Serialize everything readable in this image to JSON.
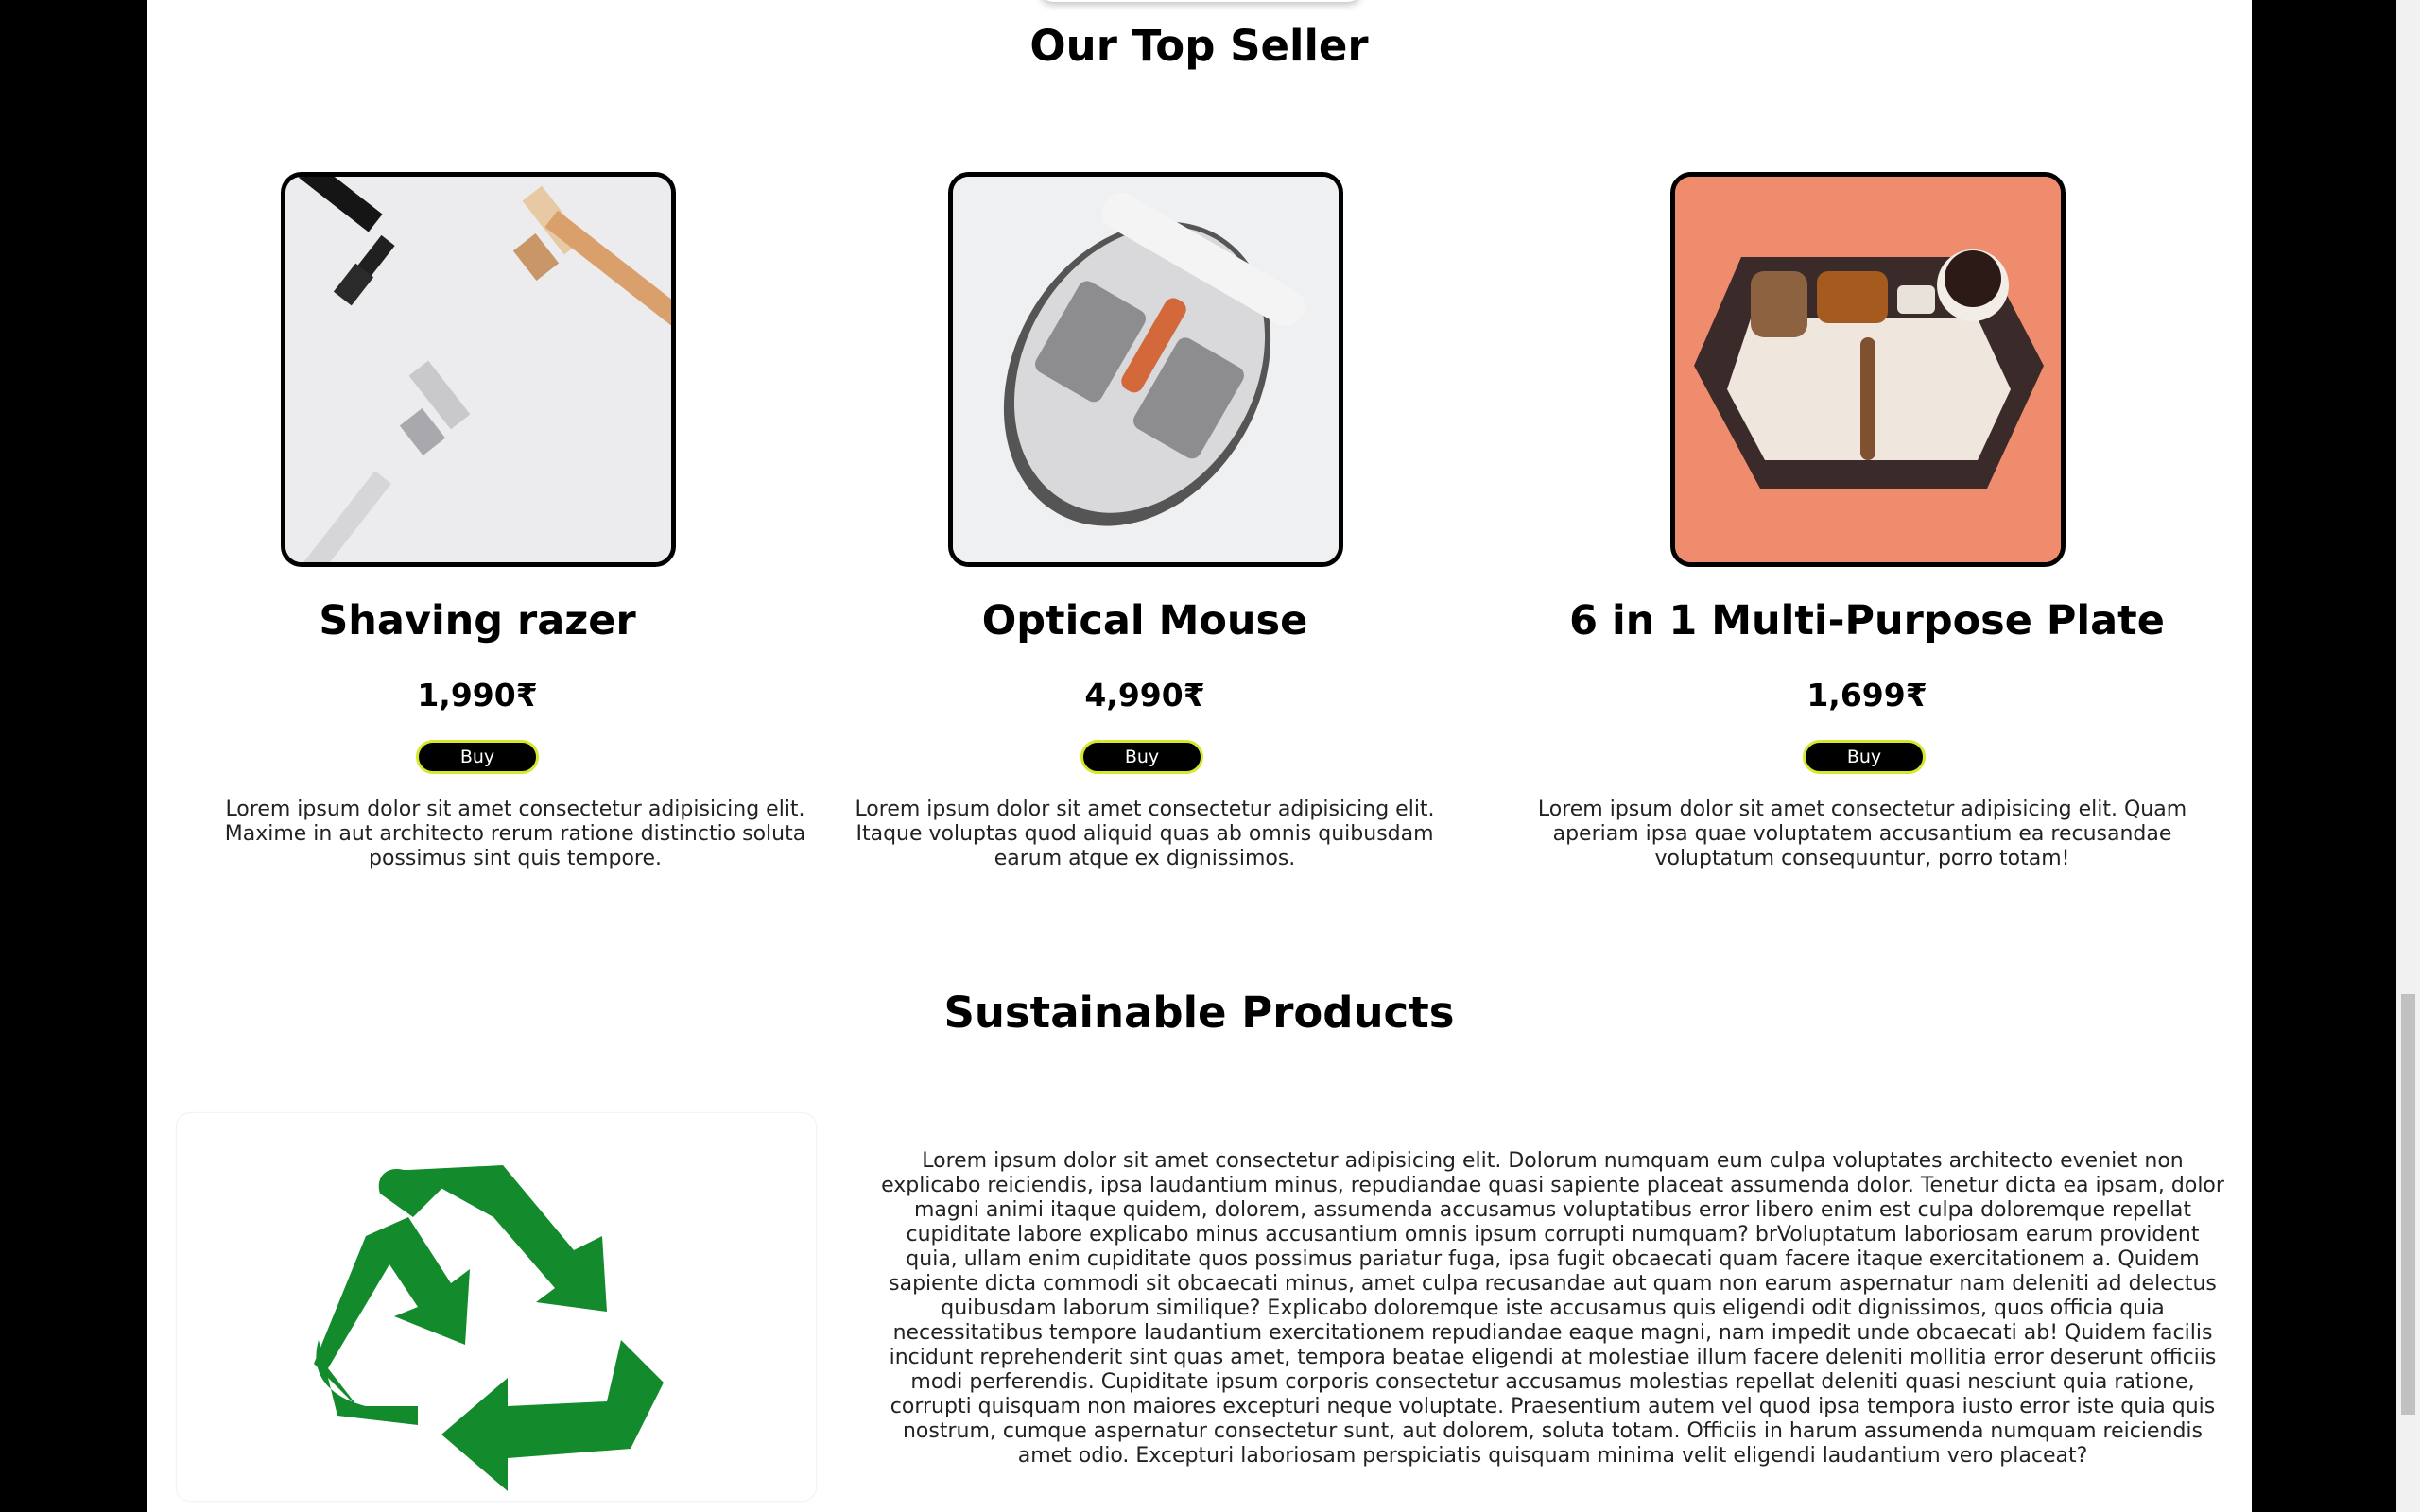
{
  "top_seller": {
    "title": "Our Top Seller",
    "products": [
      {
        "name": "Shaving razer",
        "price": "1,990₹",
        "button": "Buy",
        "description": "Lorem ipsum dolor sit amet consectetur adipisicing elit. Maxime in aut architecto rerum ratione distinctio soluta possimus sint quis tempore."
      },
      {
        "name": "Optical Mouse",
        "price": "4,990₹",
        "button": "Buy",
        "description": "Lorem ipsum dolor sit amet consectetur adipisicing elit. Itaque voluptas quod aliquid quas ab omnis quibusdam earum atque ex dignissimos."
      },
      {
        "name": "6 in 1 Multi-Purpose Plate",
        "price": "1,699₹",
        "button": "Buy",
        "description": "Lorem ipsum dolor sit amet consectetur adipisicing elit. Quam aperiam ipsa quae voluptatem accusantium ea recusandae voluptatum consequuntur, porro totam!"
      }
    ]
  },
  "sustainable": {
    "title": "Sustainable Products",
    "icon": "recycle-icon",
    "icon_color": "#138a2c",
    "description": "Lorem ipsum dolor sit amet consectetur adipisicing elit. Dolorum numquam eum culpa voluptates architecto eveniet non explicabo reiciendis, ipsa laudantium minus, repudiandae quasi sapiente placeat assumenda dolor. Tenetur dicta ea ipsam, dolor magni animi itaque quidem, dolorem, assumenda accusamus voluptatibus error libero enim est culpa doloremque repellat cupiditate labore explicabo minus accusantium omnis ipsum corrupti numquam? brVoluptatum laboriosam earum provident quia, ullam enim cupiditate quos possimus pariatur fuga, ipsa fugit obcaecati quam facere itaque exercitationem a. Quidem sapiente dicta commodi sit obcaecati minus, amet culpa recusandae aut quam non earum aspernatur nam deleniti ad delectus quibusdam laborum similique? Explicabo doloremque iste accusamus quis eligendi odit dignissimos, quos officia quia necessitatibus tempore laudantium exercitationem repudiandae eaque magni, nam impedit unde obcaecati ab! Quidem facilis incidunt reprehenderit sint quas amet, tempora beatae eligendi at molestiae illum facere deleniti mollitia error deserunt officiis modi perferendis. Cupiditate ipsum corporis consectetur accusamus molestias repellat deleniti quasi nesciunt quia ratione, corrupti quisquam non maiores excepturi neque voluptate. Praesentium autem vel quod ipsa tempora iusto error iste quia quis nostrum, cumque aspernatur consectetur sunt, aut dolorem, soluta totam. Officiis in harum assumenda numquam reiciendis amet odio. Excepturi laboriosam perspiciatis quisquam minima velit eligendi laudantium vero placeat?"
  },
  "colors": {
    "accent_button_border": "#d7e82c",
    "page_background": "#ffffff",
    "outer_background": "#000000"
  }
}
